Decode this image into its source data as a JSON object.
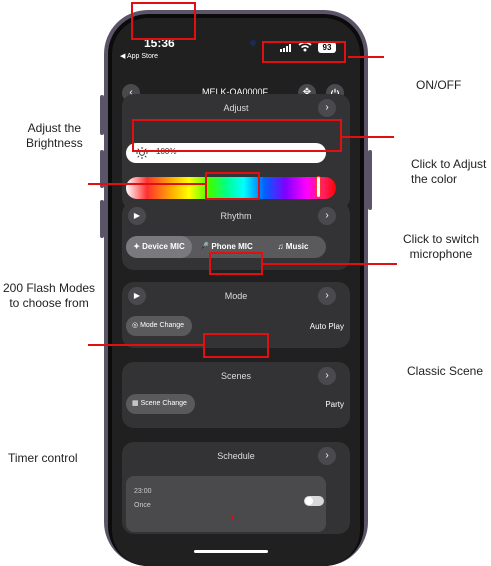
{
  "annotations": {
    "on_off": "ON/OFF",
    "adjust_brightness": "Adjust the\nBrightness",
    "adjust_color": "Click to Adjust\nthe color",
    "switch_mic": "Click to switch\nmicrophone",
    "flash_modes": "200 Flash Modes\nto choose from",
    "classic_scene": "Classic Scene",
    "timer_control": "Timer control"
  },
  "status_bar": {
    "time": "15:36",
    "back_label": "◀ App Store",
    "battery": "93"
  },
  "header": {
    "device_name": "MELK-OA0000F"
  },
  "adjust": {
    "title": "Adjust",
    "brightness": "100%"
  },
  "rhythm": {
    "title": "Rhythm",
    "tabs": [
      {
        "label": "Device MIC",
        "active": true
      },
      {
        "label": "Phone MIC",
        "active": false
      },
      {
        "label": "Music",
        "active": false
      }
    ]
  },
  "mode": {
    "title": "Mode",
    "change_label": "Mode Change",
    "value": "Auto Play"
  },
  "scenes": {
    "title": "Scenes",
    "change_label": "Scene Change",
    "value": "Party"
  },
  "schedule": {
    "title": "Schedule",
    "time": "23:00",
    "repeat": "Once",
    "enabled": true
  },
  "colors": {
    "accent": "#e01010",
    "card": "#333335",
    "screen": "#202020"
  }
}
